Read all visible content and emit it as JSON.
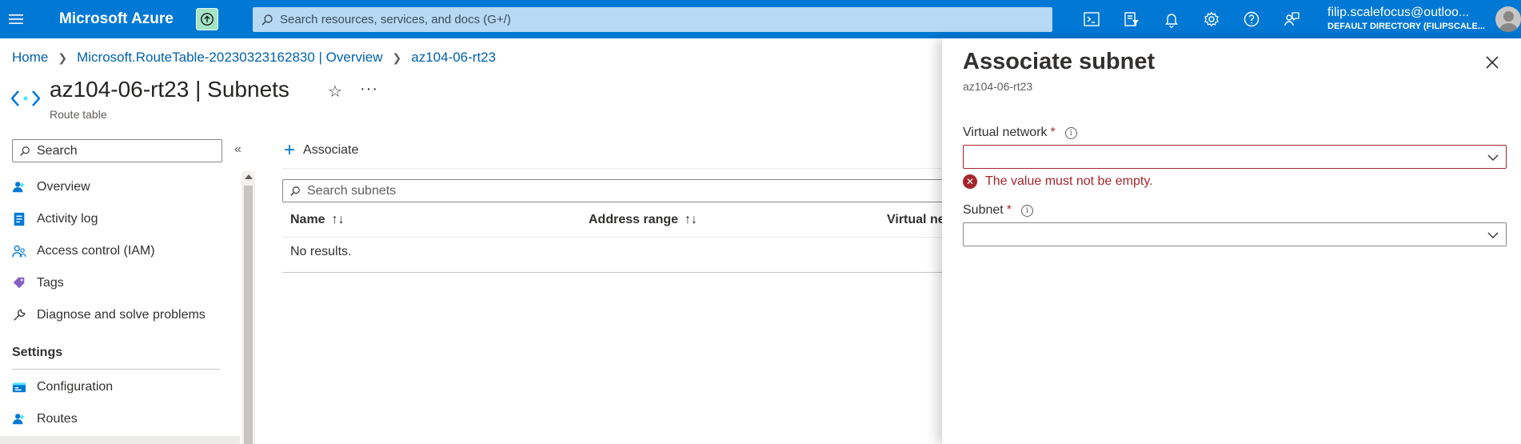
{
  "topbar": {
    "brand": "Microsoft Azure",
    "search_placeholder": "Search resources, services, and docs (G+/)",
    "account_email": "filip.scalefocus@outloo...",
    "account_directory": "DEFAULT DIRECTORY (FILIPSCALE..."
  },
  "breadcrumb": {
    "items": [
      "Home",
      "Microsoft.RouteTable-20230323162830 | Overview",
      "az104-06-rt23"
    ]
  },
  "page": {
    "resource_name": "az104-06-rt23",
    "section": " | Subnets",
    "subtitle": "Route table",
    "star": "☆",
    "more": "···"
  },
  "nav": {
    "search_placeholder": "Search",
    "collapse": "«",
    "items": [
      "Overview",
      "Activity log",
      "Access control (IAM)",
      "Tags",
      "Diagnose and solve problems"
    ],
    "settings_header": "Settings",
    "settings_items": [
      "Configuration",
      "Routes"
    ]
  },
  "content": {
    "associate_label": "Associate",
    "search_placeholder": "Search subnets",
    "columns": [
      "Name",
      "Address range",
      "Virtual ne"
    ],
    "sort_glyph": "↑↓",
    "no_results": "No results."
  },
  "panel": {
    "title": "Associate subnet",
    "subtitle": "az104-06-rt23",
    "vnet_label": "Virtual network",
    "required_mark": "*",
    "info_glyph": "i",
    "error_text": "The value must not be empty.",
    "subnet_label": "Subnet"
  },
  "colors": {
    "azure_blue": "#0078d4",
    "error_red": "#a4262c",
    "link_blue": "#0062ad"
  }
}
